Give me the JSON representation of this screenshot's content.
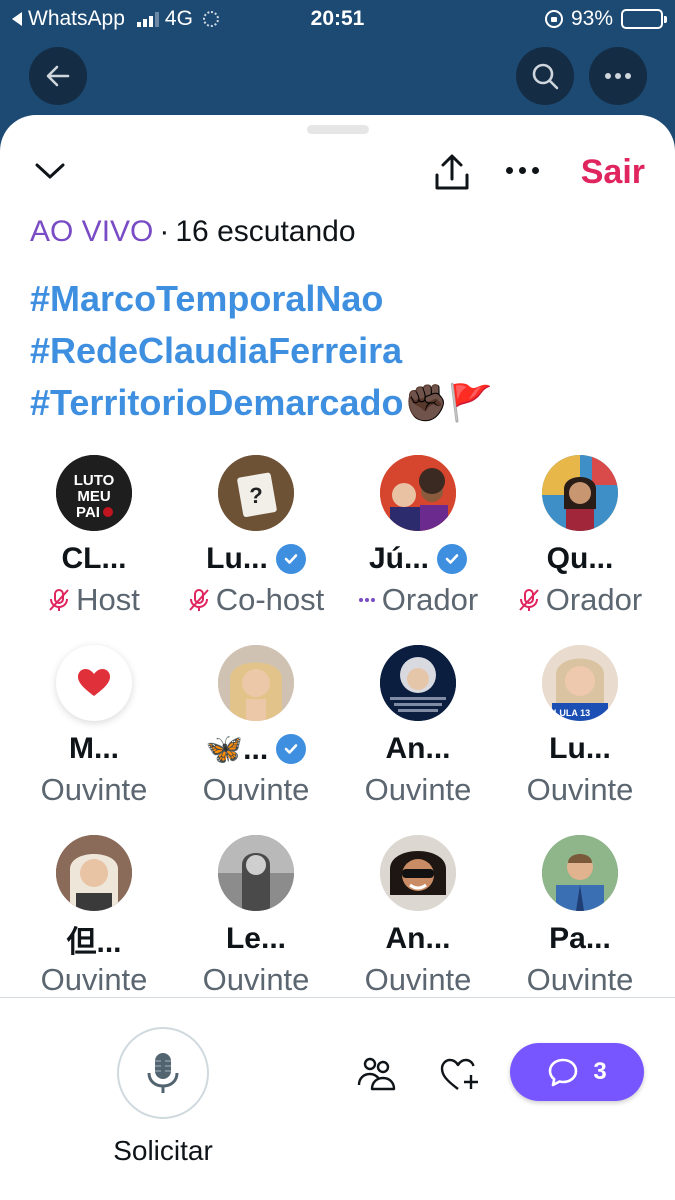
{
  "status_bar": {
    "back_app": "WhatsApp",
    "network": "4G",
    "time": "20:51",
    "battery": "93%",
    "battery_level": 0.93
  },
  "header": {
    "leave_label": "Sair"
  },
  "live": {
    "live_label": "AO VIVO",
    "separator": "·",
    "listeners": "16 escutando"
  },
  "hashtags": [
    {
      "text": "#MarcoTemporalNao",
      "emoji": ""
    },
    {
      "text": "#RedeClaudiaFerreira",
      "emoji": ""
    },
    {
      "text": "#TerritorioDemarcado",
      "emoji": "✊🏿🚩"
    }
  ],
  "participants": [
    {
      "name": "CL...",
      "role": "Host",
      "verified": false,
      "role_icon": "mic-off-icon"
    },
    {
      "name": "Lu...",
      "role": "Co-host",
      "verified": true,
      "role_icon": "mic-off-icon"
    },
    {
      "name": "Jú...",
      "role": "Orador",
      "verified": true,
      "role_icon": "speaking-dots-icon"
    },
    {
      "name": "Qu...",
      "role": "Orador",
      "verified": false,
      "role_icon": "mic-off-icon"
    },
    {
      "name": "M...",
      "role": "Ouvinte",
      "verified": false,
      "role_icon": ""
    },
    {
      "name": "🦋...",
      "role": "Ouvinte",
      "verified": true,
      "role_icon": ""
    },
    {
      "name": "An...",
      "role": "Ouvinte",
      "verified": false,
      "role_icon": ""
    },
    {
      "name": "Lu...",
      "role": "Ouvinte",
      "verified": false,
      "role_icon": ""
    },
    {
      "name": "但...",
      "role": "Ouvinte",
      "verified": false,
      "role_icon": ""
    },
    {
      "name": "Le...",
      "role": "Ouvinte",
      "verified": false,
      "role_icon": ""
    },
    {
      "name": "An...",
      "role": "Ouvinte",
      "verified": false,
      "role_icon": ""
    },
    {
      "name": "Pa...",
      "role": "Ouvinte",
      "verified": false,
      "role_icon": ""
    }
  ],
  "avatar_texts": {
    "luto": "LUTO MEU PAI",
    "lula": "LULA 13"
  },
  "bottom": {
    "request_label": "Solicitar",
    "comments_count": "3"
  },
  "colors": {
    "accent_live": "#794bc4",
    "hashtag": "#3e8fe0",
    "leave": "#e0245e",
    "comments_button": "#7856ff",
    "header_bg": "#1d4a73"
  }
}
